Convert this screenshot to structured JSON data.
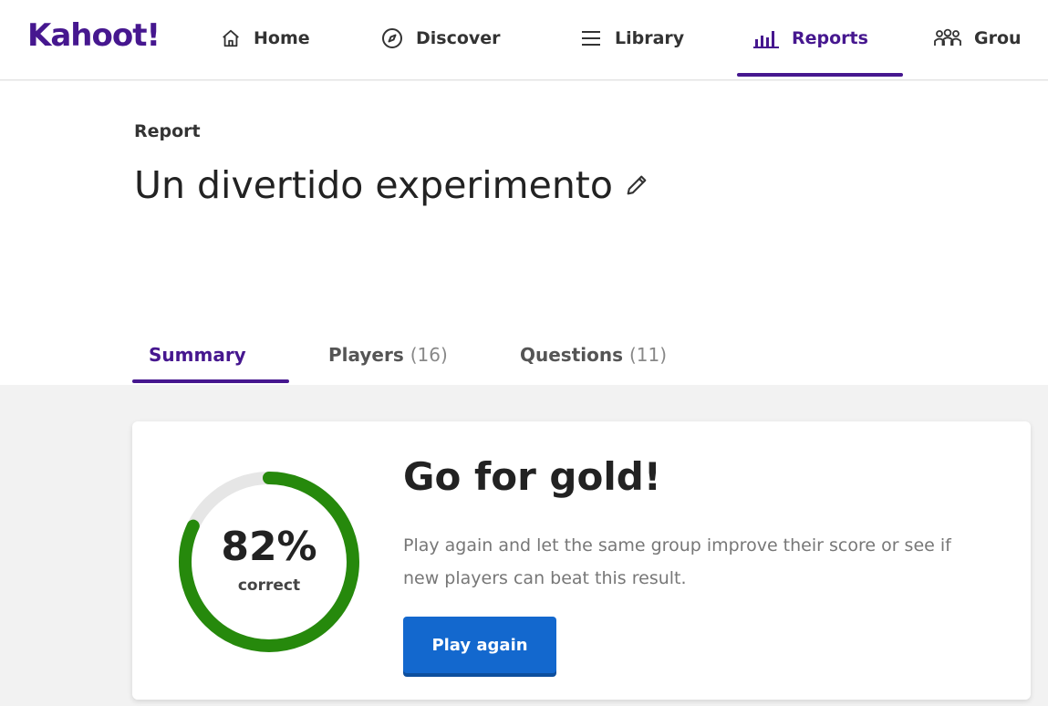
{
  "nav": {
    "logo": "Kahoot!",
    "items": [
      {
        "label": "Home",
        "icon": "home-icon"
      },
      {
        "label": "Discover",
        "icon": "compass-icon"
      },
      {
        "label": "Library",
        "icon": "list-icon"
      },
      {
        "label": "Reports",
        "icon": "bar-chart-icon",
        "active": true
      },
      {
        "label": "Grou",
        "icon": "groups-icon"
      }
    ]
  },
  "header": {
    "label": "Report",
    "title": "Un divertido experimento",
    "edit_icon": "pencil-icon"
  },
  "tabs": [
    {
      "label": "Summary",
      "count": "",
      "active": true
    },
    {
      "label": "Players",
      "count": "(16)"
    },
    {
      "label": "Questions",
      "count": "(11)"
    }
  ],
  "summary": {
    "percent": 82,
    "percent_label": "82%",
    "caption": "correct",
    "title": "Go for gold!",
    "description": "Play again and let the same group improve their score or see if new players can beat this result.",
    "button_label": "Play again"
  },
  "colors": {
    "brand": "#46178f",
    "ring": "#26890c",
    "ring_track": "#e6e6e6",
    "button": "#1368ce"
  }
}
